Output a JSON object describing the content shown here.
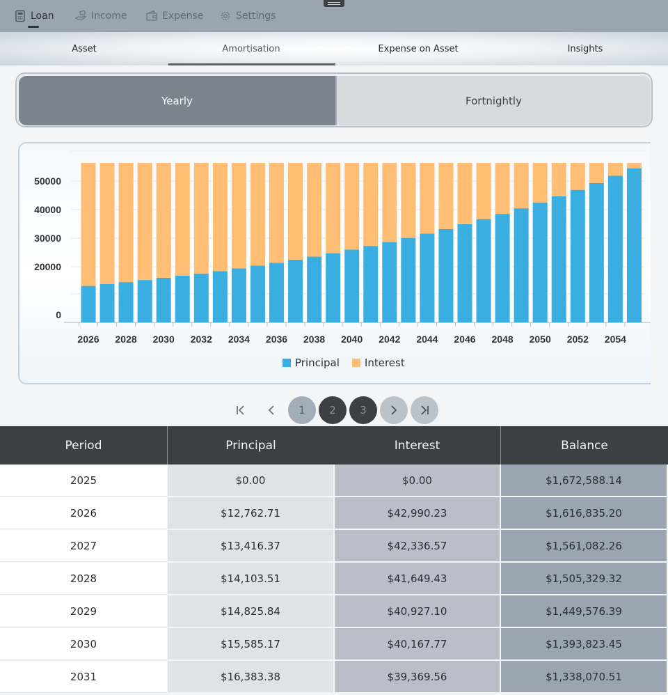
{
  "nav": {
    "items": [
      {
        "label": "Loan",
        "icon": "calculator-icon",
        "active": true
      },
      {
        "label": "Income",
        "icon": "hand-money-icon",
        "active": false
      },
      {
        "label": "Expense",
        "icon": "wallet-icon",
        "active": false
      },
      {
        "label": "Settings",
        "icon": "gear-icon",
        "active": false
      }
    ]
  },
  "subtabs": [
    {
      "label": "Asset",
      "active": false
    },
    {
      "label": "Amortisation",
      "active": true
    },
    {
      "label": "Expense on Asset",
      "active": false
    },
    {
      "label": "Insights",
      "active": false
    }
  ],
  "segment": {
    "yearly": "Yearly",
    "fortnightly": "Fortnightly",
    "selected": "Yearly"
  },
  "colors": {
    "principal": "#3aaee0",
    "interest": "#ffbe73",
    "header": "#3c4044"
  },
  "chart_data": {
    "type": "bar",
    "stacked": true,
    "x": [
      2026,
      2027,
      2028,
      2029,
      2030,
      2031,
      2032,
      2033,
      2034,
      2035,
      2036,
      2037,
      2038,
      2039,
      2040,
      2041,
      2042,
      2043,
      2044,
      2045,
      2046,
      2047,
      2048,
      2049,
      2050,
      2051,
      2052,
      2053,
      2054,
      2055
    ],
    "x_tick_labels": [
      "2026",
      "2028",
      "2030",
      "2032",
      "2034",
      "2036",
      "2038",
      "2040",
      "2042",
      "2044",
      "2046",
      "2048",
      "2050",
      "2052",
      "2054"
    ],
    "y_tick_labels": [
      "0",
      "20000",
      "30000",
      "40000",
      "50000"
    ],
    "series": [
      {
        "name": "Principal",
        "values": [
          12762.71,
          13416.37,
          14103.51,
          14825.84,
          15585.17,
          16383.38,
          17100,
          17950,
          18900,
          19850,
          20850,
          21900,
          23000,
          24200,
          25450,
          26750,
          28100,
          29550,
          31100,
          32650,
          34350,
          36100,
          37950,
          39900,
          41950,
          44100,
          46350,
          48750,
          51250,
          53900
        ]
      },
      {
        "name": "Interest",
        "values": [
          42990.23,
          42336.57,
          41649.43,
          40927.1,
          40167.77,
          39369.56,
          38650,
          37800,
          36850,
          35900,
          34900,
          33850,
          32750,
          31550,
          30300,
          29000,
          27650,
          26200,
          24650,
          23100,
          21400,
          19650,
          17800,
          15850,
          13800,
          11650,
          9400,
          7000,
          4500,
          1850
        ]
      }
    ],
    "legend": [
      "Principal",
      "Interest"
    ],
    "legend_position": "bottom",
    "grid": true
  },
  "pager": {
    "pages": [
      "1",
      "2",
      "3"
    ],
    "current": "1"
  },
  "table": {
    "headers": [
      "Period",
      "Principal",
      "Interest",
      "Balance"
    ],
    "rows": [
      [
        "2025",
        "$0.00",
        "$0.00",
        "$1,672,588.14"
      ],
      [
        "2026",
        "$12,762.71",
        "$42,990.23",
        "$1,616,835.20"
      ],
      [
        "2027",
        "$13,416.37",
        "$42,336.57",
        "$1,561,082.26"
      ],
      [
        "2028",
        "$14,103.51",
        "$41,649.43",
        "$1,505,329.32"
      ],
      [
        "2029",
        "$14,825.84",
        "$40,927.10",
        "$1,449,576.39"
      ],
      [
        "2030",
        "$15,585.17",
        "$40,167.77",
        "$1,393,823.45"
      ],
      [
        "2031",
        "$16,383.38",
        "$39,369.56",
        "$1,338,070.51"
      ]
    ]
  }
}
